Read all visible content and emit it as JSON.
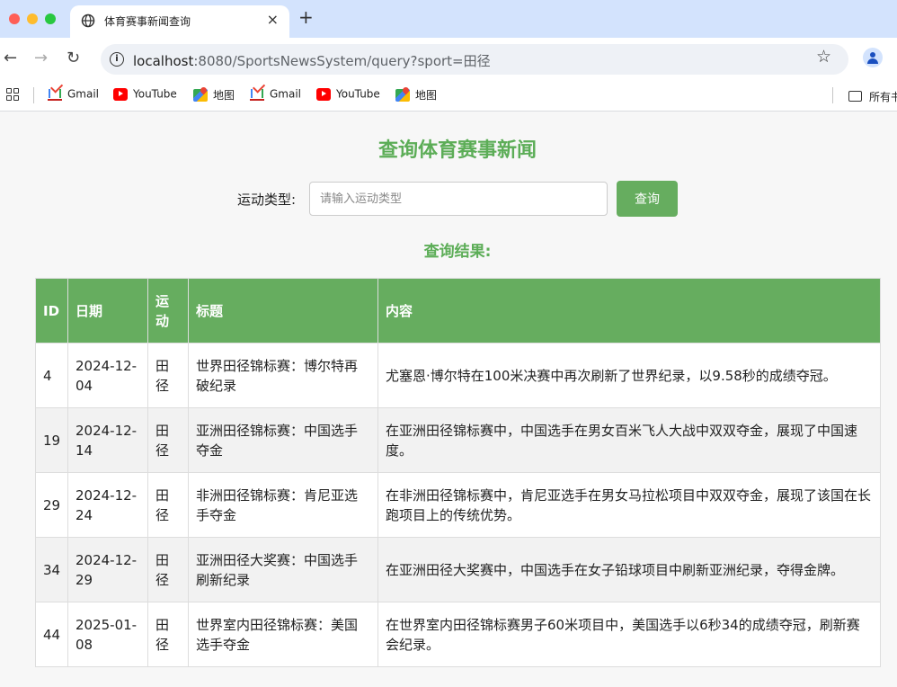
{
  "browser": {
    "tab": {
      "title": "体育赛事新闻查询",
      "close_icon": "×",
      "icon": "globe-icon"
    },
    "new_tab": "+",
    "url": {
      "host": "localhost",
      "path": ":8080/SportsNewsSystem/query?sport=田径"
    },
    "bookmarks": [
      {
        "label": "Gmail",
        "icon": "gmail-icon"
      },
      {
        "label": "YouTube",
        "icon": "youtube-icon"
      },
      {
        "label": "地图",
        "icon": "maps-icon"
      },
      {
        "label": "Gmail",
        "icon": "gmail-icon"
      },
      {
        "label": "YouTube",
        "icon": "youtube-icon"
      },
      {
        "label": "地图",
        "icon": "maps-icon"
      }
    ],
    "all_bookmarks_label": "所有书签"
  },
  "page": {
    "title": "查询体育赛事新闻",
    "form": {
      "label": "运动类型:",
      "input_value": "",
      "input_placeholder": "请输入运动类型",
      "submit_label": "查询"
    },
    "results_title": "查询结果:",
    "table": {
      "headers": {
        "id": "ID",
        "date": "日期",
        "sport": "运动",
        "title": "标题",
        "content": "内容"
      },
      "rows": [
        {
          "id": "4",
          "date": "2024-12-04",
          "sport": "田径",
          "title": "世界田径锦标赛：博尔特再破纪录",
          "content": "尤塞恩·博尔特在100米决赛中再次刷新了世界纪录，以9.58秒的成绩夺冠。"
        },
        {
          "id": "19",
          "date": "2024-12-14",
          "sport": "田径",
          "title": "亚洲田径锦标赛：中国选手夺金",
          "content": "在亚洲田径锦标赛中，中国选手在男女百米飞人大战中双双夺金，展现了中国速度。"
        },
        {
          "id": "29",
          "date": "2024-12-24",
          "sport": "田径",
          "title": "非洲田径锦标赛：肯尼亚选手夺金",
          "content": "在非洲田径锦标赛中，肯尼亚选手在男女马拉松项目中双双夺金，展现了该国在长跑项目上的传统优势。"
        },
        {
          "id": "34",
          "date": "2024-12-29",
          "sport": "田径",
          "title": "亚洲田径大奖赛：中国选手刷新纪录",
          "content": "在亚洲田径大奖赛中，中国选手在女子铅球项目中刷新亚洲纪录，夺得金牌。"
        },
        {
          "id": "44",
          "date": "2025-01-08",
          "sport": "田径",
          "title": "世界室内田径锦标赛：美国选手夺金",
          "content": "在世界室内田径锦标赛男子60米项目中，美国选手以6秒34的成绩夺冠，刷新赛会纪录。"
        }
      ]
    }
  },
  "colors": {
    "accent": "#66ad5f",
    "title_green": "#5cad57",
    "tab_strip": "#d3e3fd"
  }
}
